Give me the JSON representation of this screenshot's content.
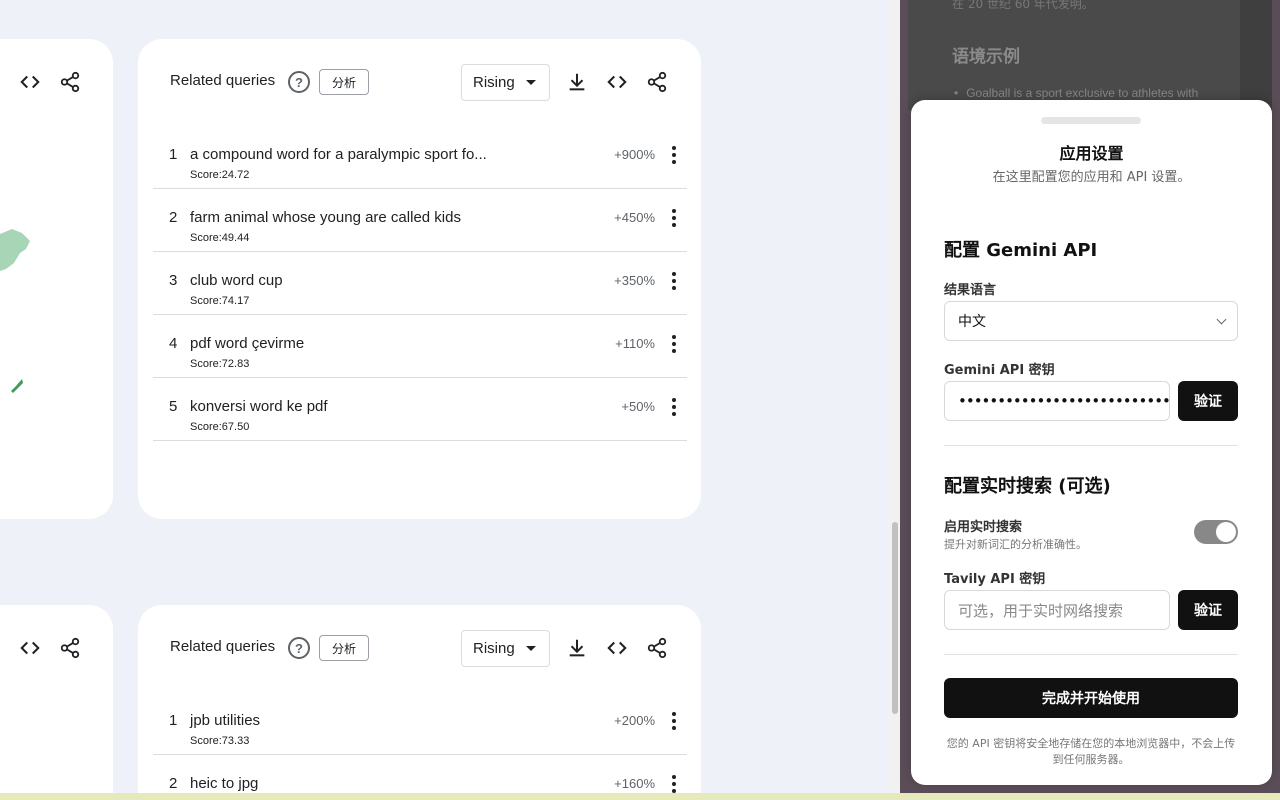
{
  "cards": [
    {
      "title": "Related queries",
      "help_glyph": "?",
      "analyze_label": "分析",
      "filter": "Rising",
      "rows": [
        {
          "rank": "1",
          "query": "a compound word for a paralympic sport fo...",
          "score": "Score:24.72",
          "change": "+900%"
        },
        {
          "rank": "2",
          "query": "farm animal whose young are called kids",
          "score": "Score:49.44",
          "change": "+450%"
        },
        {
          "rank": "3",
          "query": "club word cup",
          "score": "Score:74.17",
          "change": "+350%"
        },
        {
          "rank": "4",
          "query": "pdf word çevirme",
          "score": "Score:72.83",
          "change": "+110%"
        },
        {
          "rank": "5",
          "query": "konversi word ke pdf",
          "score": "Score:67.50",
          "change": "+50%"
        }
      ]
    },
    {
      "title": "Related queries",
      "help_glyph": "?",
      "analyze_label": "分析",
      "filter": "Rising",
      "rows": [
        {
          "rank": "1",
          "query": "jpb utilities",
          "score": "Score:73.33",
          "change": "+200%"
        },
        {
          "rank": "2",
          "query": "heic to jpg",
          "score": "",
          "change": "+160%"
        }
      ]
    }
  ],
  "background_doc": {
    "top_text": "在 20 世纪 60 年代发明。",
    "heading": "语境示例",
    "bullet": "Goalball is a sport exclusive to athletes with"
  },
  "settings": {
    "title": "应用设置",
    "subtitle": "在这里配置您的应用和 API 设置。",
    "gemini_section": "配置 Gemini API",
    "lang_label": "结果语言",
    "lang_value": "中文",
    "gemini_key_label": "Gemini API 密钥",
    "gemini_key_value": "••••••••••••••••••••••••••••••••••••",
    "verify_label": "验证",
    "search_section": "配置实时搜索 (可选)",
    "realtime_label": "启用实时搜索",
    "realtime_desc": "提升对新词汇的分析准确性。",
    "realtime_on": true,
    "tavily_label": "Tavily API 密钥",
    "tavily_placeholder": "可选，用于实时网络搜索",
    "finish_label": "完成并开始使用",
    "footnote": "您的 API 密钥将安全地存储在您的本地浏览器中，不会上传到任何服务器。"
  },
  "colors": {
    "page_bg": "#eef1f7",
    "accent_dark": "#111111",
    "toggle_on": "#888888",
    "map_green": "#a8d5b5"
  }
}
